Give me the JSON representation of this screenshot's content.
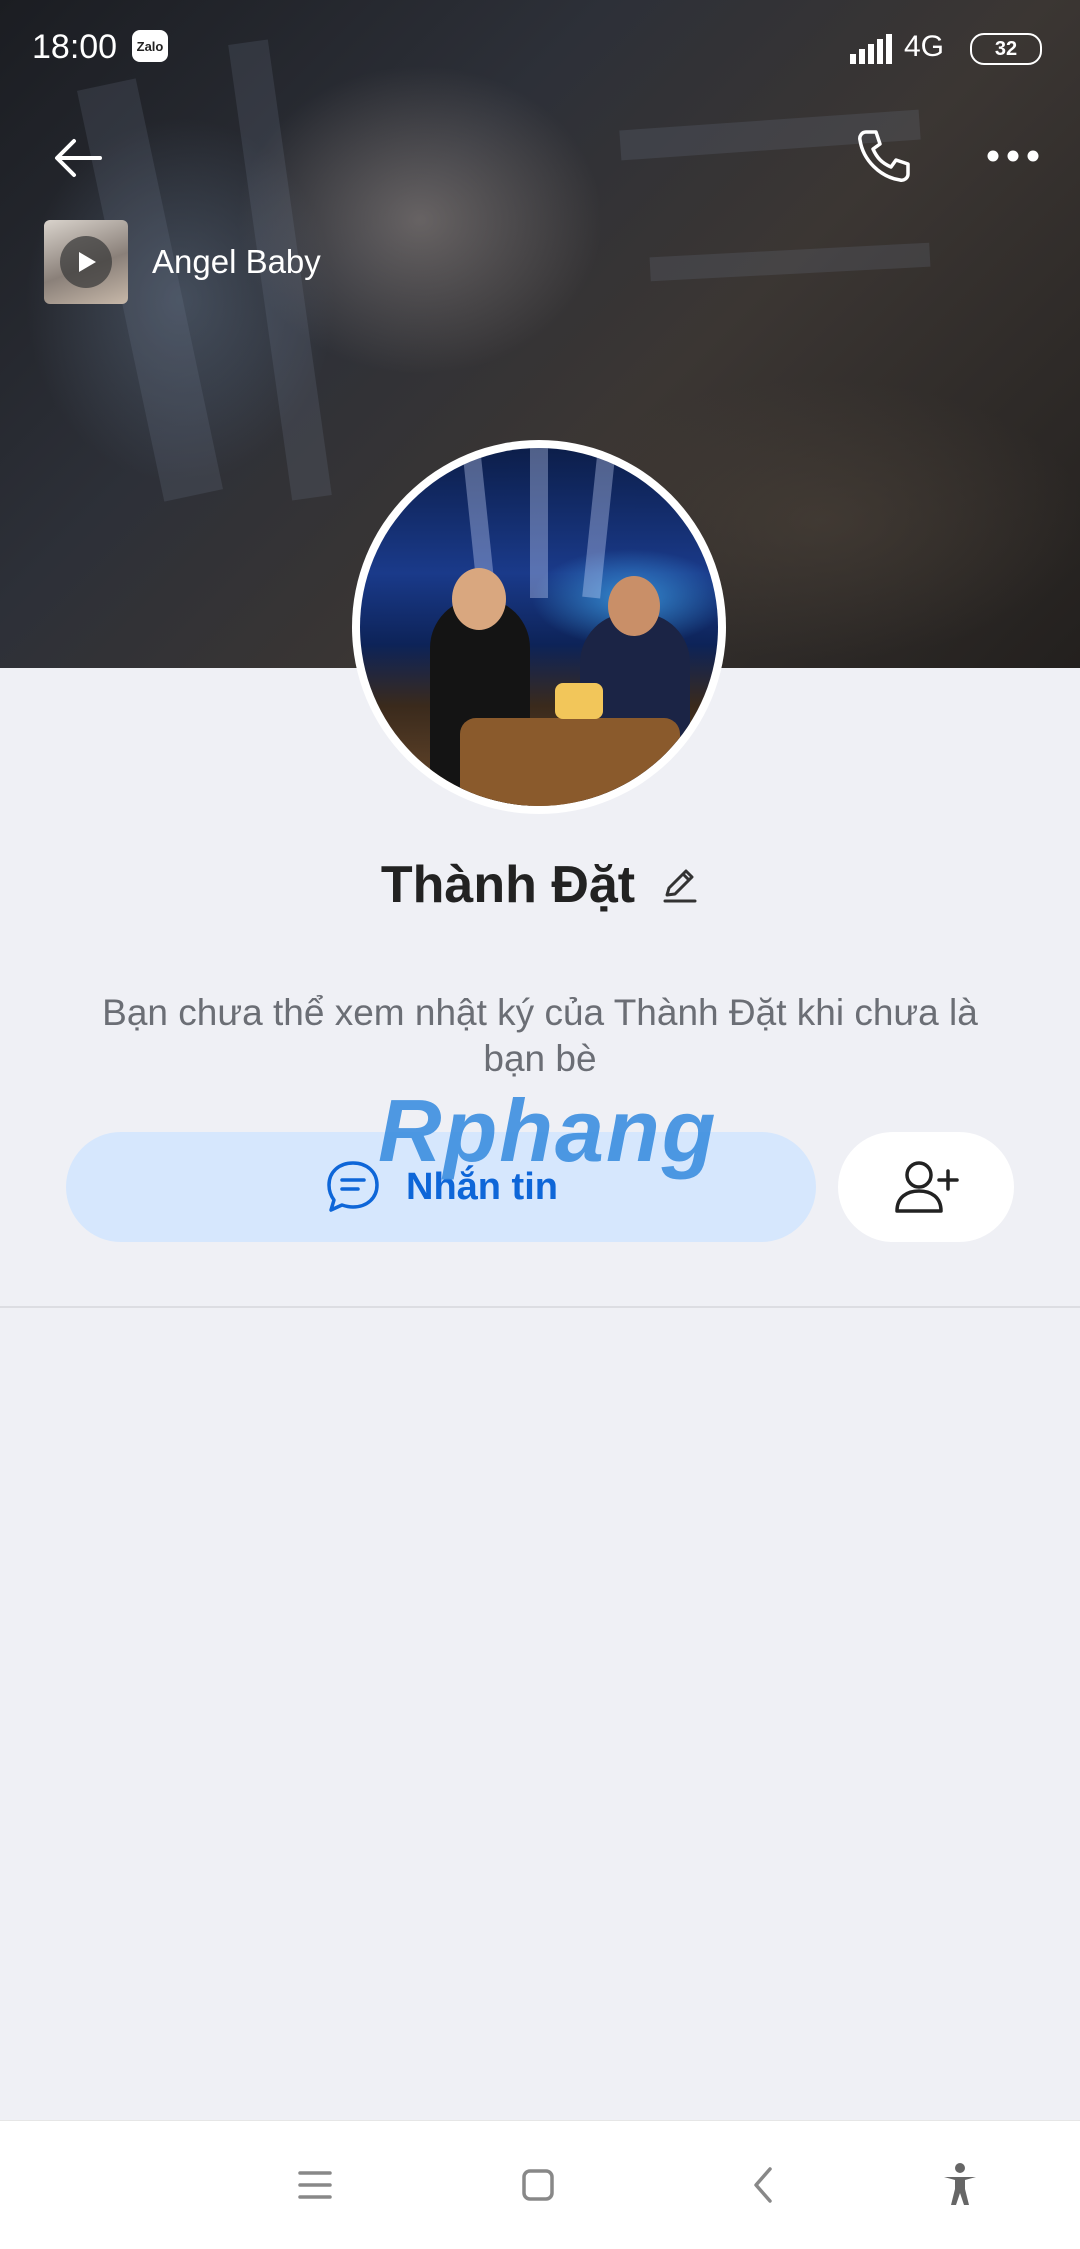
{
  "status_bar": {
    "time": "18:00",
    "app_badge": "Zalo",
    "network": "4G",
    "battery": "32"
  },
  "cover": {
    "music": {
      "title": "Angel Baby"
    }
  },
  "profile": {
    "name": "Thành Đặt",
    "info_text": "Bạn chưa thể xem nhật ký của Thành Đặt khi chưa là bạn bè"
  },
  "actions": {
    "message_label": "Nhắn tin"
  },
  "watermark": "Rphang",
  "colors": {
    "background": "#eff0f5",
    "message_button_bg": "#d6e7fd",
    "accent_blue": "#0e66d8"
  },
  "icons": {
    "back": "arrow-left-icon",
    "call": "phone-icon",
    "more": "more-horizontal-icon",
    "play": "play-icon",
    "edit": "pencil-icon",
    "message": "chat-bubble-icon",
    "add_friend": "user-plus-icon",
    "nav_menu": "menu-icon",
    "nav_home": "square-icon",
    "nav_back": "chevron-left-icon",
    "nav_accessibility": "accessibility-icon"
  }
}
